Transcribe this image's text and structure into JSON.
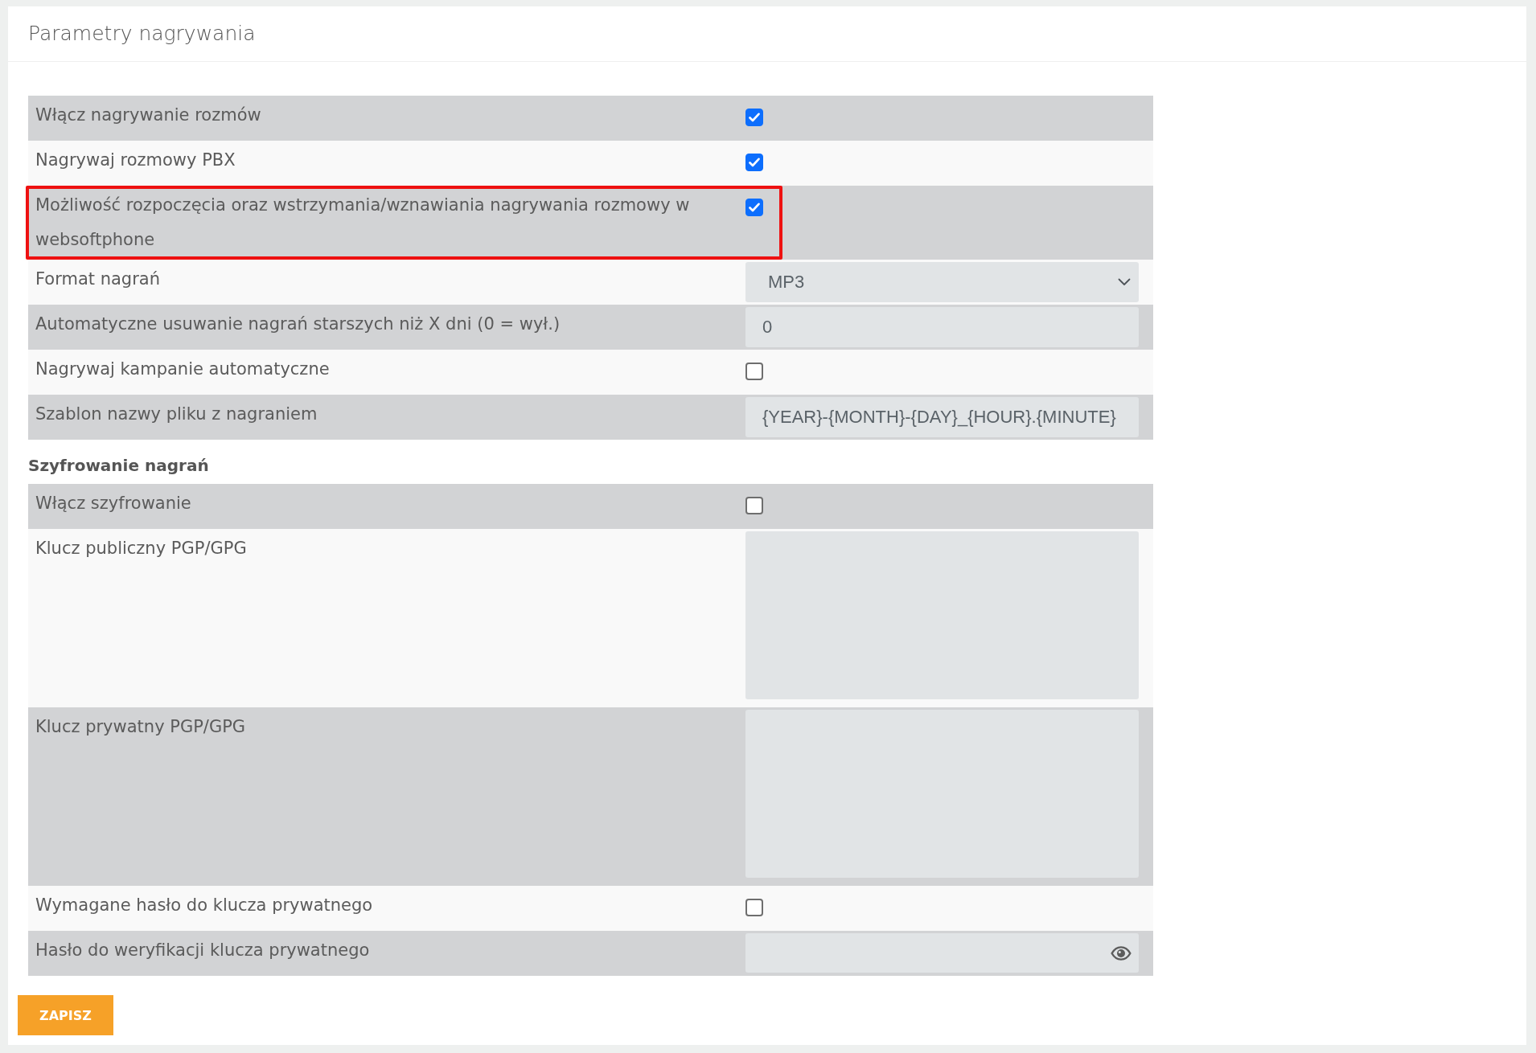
{
  "page": {
    "title": "Parametry nagrywania"
  },
  "sections": [
    {
      "rows": [
        {
          "kind": "checkbox",
          "label": "Włącz nagrywanie rozmów",
          "checked": true,
          "highlighted": false
        },
        {
          "kind": "checkbox",
          "label": "Nagrywaj rozmowy PBX",
          "checked": true,
          "highlighted": false
        },
        {
          "kind": "checkbox",
          "label": "Możliwość rozpoczęcia oraz wstrzymania/wznawiania nagrywania rozmowy w websoftphone",
          "checked": true,
          "highlighted": true
        },
        {
          "kind": "select",
          "label": "Format nagrań",
          "value": "MP3",
          "highlighted": false
        },
        {
          "kind": "text",
          "label": "Automatyczne usuwanie nagrań starszych niż X dni (0 = wył.)",
          "value": "0",
          "highlighted": false
        },
        {
          "kind": "checkbox",
          "label": "Nagrywaj kampanie automatyczne",
          "checked": false,
          "highlighted": false
        },
        {
          "kind": "text",
          "label": "Szablon nazwy pliku z nagraniem",
          "value": "{YEAR}-{MONTH}-{DAY}_{HOUR}.{MINUTE}",
          "highlighted": false
        }
      ]
    },
    {
      "heading": "Szyfrowanie nagrań",
      "rows": [
        {
          "kind": "checkbox",
          "label": "Włącz szyfrowanie",
          "checked": false,
          "highlighted": false
        },
        {
          "kind": "textarea",
          "label": "Klucz publiczny PGP/GPG",
          "highlighted": false
        },
        {
          "kind": "textarea",
          "label": "Klucz prywatny PGP/GPG",
          "highlighted": false
        },
        {
          "kind": "checkbox",
          "label": "Wymagane hasło do klucza prywatnego",
          "checked": false,
          "highlighted": false
        },
        {
          "kind": "password",
          "label": "Hasło do weryfikacji klucza prywatnego",
          "highlighted": false
        }
      ]
    }
  ],
  "save_button": {
    "label": "ZAPISZ"
  }
}
